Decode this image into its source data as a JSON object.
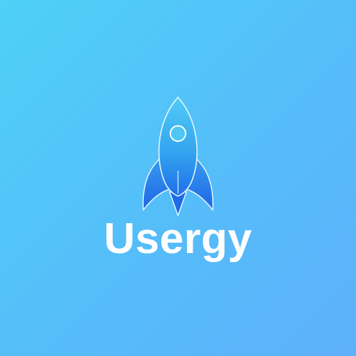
{
  "app": {
    "name": "Usergy",
    "logo_icon": "rocket-icon"
  },
  "colors": {
    "background_start": "#4ed0f7",
    "background_end": "#5fb0fb",
    "rocket_light": "#52ccf5",
    "rocket_dark": "#1f6fe9",
    "text": "#ffffff"
  }
}
